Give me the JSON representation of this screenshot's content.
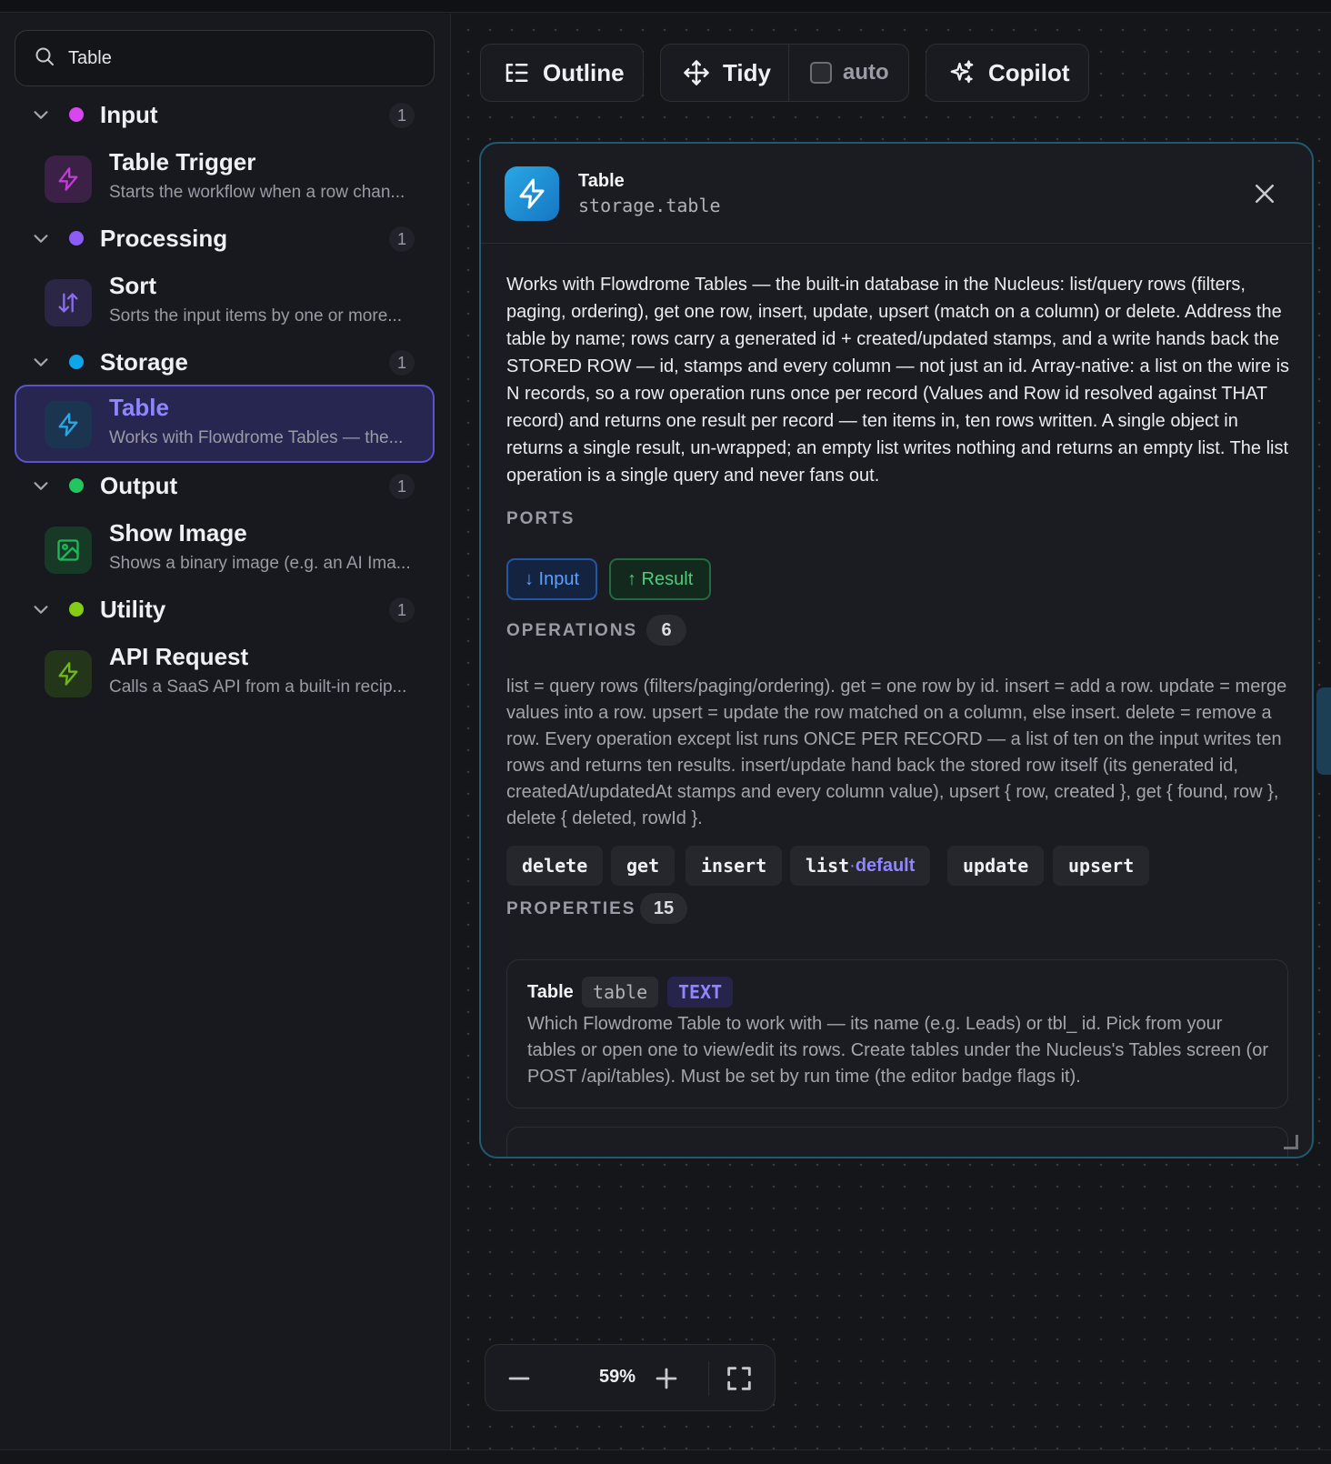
{
  "search": {
    "value": "Table",
    "icon": "search-icon"
  },
  "groups": [
    {
      "name": "Input",
      "count": "1",
      "color": "#d946ef",
      "item": {
        "title": "Table Trigger",
        "desc": "Starts the workflow when a row chan...",
        "icon": "lightning-icon",
        "icon_color": "#c13bd6",
        "icon_bg": "#3a2145"
      }
    },
    {
      "name": "Processing",
      "count": "1",
      "color": "#8b5cf6",
      "item": {
        "title": "Sort",
        "desc": "Sorts the input items by one or more...",
        "icon": "sort-arrows-icon",
        "icon_color": "#8b6cf0",
        "icon_bg": "#2b2546"
      }
    },
    {
      "name": "Storage",
      "count": "1",
      "color": "#0ea5e9",
      "item": {
        "title": "Table",
        "desc": "Works with Flowdrome Tables — the...",
        "icon": "lightning-icon",
        "icon_color": "#2aa6e6",
        "icon_bg": "#1b3550",
        "selected": true
      }
    },
    {
      "name": "Output",
      "count": "1",
      "color": "#22c55e",
      "item": {
        "title": "Show Image",
        "desc": "Shows a binary image (e.g. an AI Ima...",
        "icon": "image-icon",
        "icon_color": "#22b55a",
        "icon_bg": "#173a27"
      }
    },
    {
      "name": "Utility",
      "count": "1",
      "color": "#84cc16",
      "item": {
        "title": "API Request",
        "desc": "Calls a SaaS API from a built-in recip...",
        "icon": "lightning-icon",
        "icon_color": "#6fb520",
        "icon_bg": "#24361a"
      }
    }
  ],
  "toolbar": {
    "outline": "Outline",
    "tidy": "Tidy",
    "auto": "auto",
    "copilot": "Copilot"
  },
  "panel": {
    "title": "Table",
    "type": "storage.table",
    "description": "Works with Flowdrome Tables — the built-in database in the Nucleus: list/query rows (filters, paging, ordering), get one row, insert, update, upsert (match on a column) or delete. Address the table by name; rows carry a generated id + created/updated stamps, and a write hands back the STORED ROW — id, stamps and every column — not just an id. Array-native: a list on the wire is N records, so a row operation runs once per record (Values and Row id resolved against THAT record) and returns one result per record — ten items in, ten rows written. A single object in returns a single result, un-wrapped; an empty list writes nothing and returns an empty list. The list operation is a single query and never fans out.",
    "ports_label": "PORTS",
    "ports": {
      "input": "↓ Input",
      "output": "↑ Result"
    },
    "operations_label": "OPERATIONS",
    "operations_count": "6",
    "operations_desc": "list = query rows (filters/paging/ordering). get = one row by id. insert = add a row. update = merge values into a row. upsert = update the row matched on a column, else insert. delete = remove a row. Every operation except list runs ONCE PER RECORD — a list of ten on the input writes ten rows and returns ten results. insert/update hand back the stored row itself (its generated id, createdAt/updatedAt stamps and every column value), upsert { row, created }, get { found, row }, delete { deleted, rowId }.",
    "operations": [
      "delete",
      "get",
      "insert",
      "list",
      "update",
      "upsert"
    ],
    "default_sep": " · ",
    "default_label": "default",
    "properties_label": "PROPERTIES",
    "properties_count": "15",
    "property": {
      "name": "Table",
      "key": "table",
      "type": "TEXT",
      "desc": "Which Flowdrome Table to work with — its name (e.g. Leads) or tbl_ id. Pick from your tables or open one to view/edit its rows. Create tables under the Nucleus's Tables screen (or POST /api/tables). Must be set by run time (the editor badge flags it)."
    }
  },
  "zoom": {
    "value": "59%"
  },
  "colors": {
    "accent": "#8f86ff",
    "panel_border": "#1f5a70",
    "selected_bg": "#272650"
  }
}
